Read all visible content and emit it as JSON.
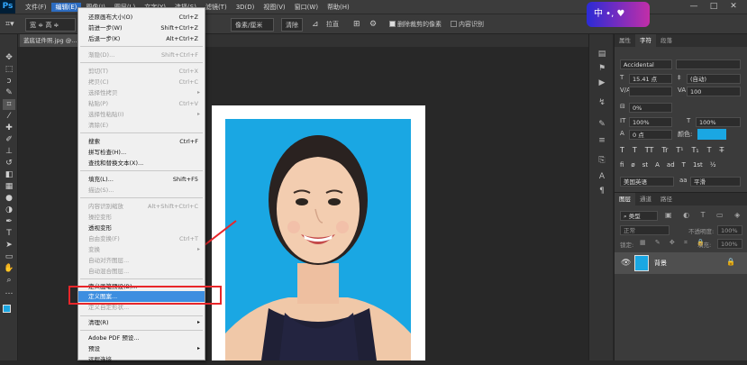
{
  "app": {
    "logo": "Ps"
  },
  "menubar": {
    "items": [
      "文件(F)",
      "编辑(E)",
      "图像(I)",
      "图层(L)",
      "文字(Y)",
      "选择(S)",
      "滤镜(T)",
      "3D(D)",
      "视图(V)",
      "窗口(W)",
      "帮助(H)"
    ],
    "active_index": 1
  },
  "window_controls": [
    "—",
    "□",
    "✕"
  ],
  "options": {
    "width_label": "宽 ≑ 高 ≑ 分..",
    "units": "像素/厘米",
    "clear": "清除",
    "straighten": "拉直",
    "delete_cropped": "删除裁剪的像素",
    "content_aware": "内容识别"
  },
  "ime": {
    "text": "中 •,  ♥"
  },
  "document": {
    "tab_title": "蓝底证件照.jpg @..."
  },
  "edit_menu": {
    "items": [
      {
        "label": "还原画布大小(O)",
        "shortcut": "Ctrl+Z",
        "disabled": false
      },
      {
        "label": "前进一步(W)",
        "shortcut": "Shift+Ctrl+Z",
        "disabled": false
      },
      {
        "label": "后退一步(K)",
        "shortcut": "Alt+Ctrl+Z",
        "disabled": false
      },
      {
        "label": "渐隐(D)...",
        "shortcut": "Shift+Ctrl+F",
        "disabled": true
      },
      {
        "label": "剪切(T)",
        "shortcut": "Ctrl+X",
        "disabled": true
      },
      {
        "label": "拷贝(C)",
        "shortcut": "Ctrl+C",
        "disabled": true
      },
      {
        "label": "选择性拷贝",
        "shortcut": "",
        "disabled": true,
        "submenu": true
      },
      {
        "label": "粘贴(P)",
        "shortcut": "Ctrl+V",
        "disabled": true
      },
      {
        "label": "选择性粘贴(I)",
        "shortcut": "",
        "disabled": true,
        "submenu": true
      },
      {
        "label": "清除(E)",
        "shortcut": "",
        "disabled": true
      },
      {
        "label": "搜索",
        "shortcut": "Ctrl+F",
        "disabled": false
      },
      {
        "label": "拼写检查(H)...",
        "shortcut": "",
        "disabled": false
      },
      {
        "label": "查找和替换文本(X)...",
        "shortcut": "",
        "disabled": false
      },
      {
        "label": "填充(L)...",
        "shortcut": "Shift+F5",
        "disabled": false
      },
      {
        "label": "描边(S)...",
        "shortcut": "",
        "disabled": true
      },
      {
        "label": "内容识别缩放",
        "shortcut": "Alt+Shift+Ctrl+C",
        "disabled": true
      },
      {
        "label": "操控变形",
        "shortcut": "",
        "disabled": true
      },
      {
        "label": "透视变形",
        "shortcut": "",
        "disabled": false
      },
      {
        "label": "自由变换(F)",
        "shortcut": "Ctrl+T",
        "disabled": true
      },
      {
        "label": "变换",
        "shortcut": "",
        "disabled": true,
        "submenu": true
      },
      {
        "label": "自动对齐图层...",
        "shortcut": "",
        "disabled": true
      },
      {
        "label": "自动混合图层...",
        "shortcut": "",
        "disabled": true
      },
      {
        "label": "定义画笔预设(B)...",
        "shortcut": "",
        "disabled": false
      },
      {
        "label": "定义图案...",
        "shortcut": "",
        "disabled": false,
        "highlighted": true
      },
      {
        "label": "定义自定形状...",
        "shortcut": "",
        "disabled": true
      },
      {
        "label": "清理(R)",
        "shortcut": "",
        "disabled": false,
        "submenu": true
      },
      {
        "label": "Adobe PDF 预设...",
        "shortcut": "",
        "disabled": false
      },
      {
        "label": "预设",
        "shortcut": "",
        "disabled": false,
        "submenu": true
      },
      {
        "label": "远程连接...",
        "shortcut": "",
        "disabled": false
      }
    ]
  },
  "char_panel": {
    "tabs": [
      "属性",
      "字符",
      "段落"
    ],
    "active_tab": 1,
    "font": "Accidental Pres...",
    "size": "15.41 点",
    "leading": "(自动)",
    "kerning": "V/A",
    "tracking": "100",
    "percent": "0%",
    "vscale": "100%",
    "hscale": "100%",
    "baseline": "0 点",
    "color_label": "颜色:",
    "color": "#1aa7e3",
    "language": "美国英语",
    "aa": "平滑",
    "styles": [
      "T",
      "T",
      "TT",
      "Tr",
      "T¹",
      "T₁",
      "T",
      "T̶"
    ],
    "extra": [
      "fi",
      "ø",
      "st",
      "A",
      "ad",
      "T",
      "1st",
      "½"
    ]
  },
  "layers_panel": {
    "tabs": [
      "图层",
      "通道",
      "路径"
    ],
    "kind": "类型",
    "blend": "正常",
    "opacity_label": "不透明度:",
    "opacity": "100%",
    "lock_label": "锁定:",
    "fill_label": "填充:",
    "fill": "100%",
    "layer_name": "背景"
  }
}
